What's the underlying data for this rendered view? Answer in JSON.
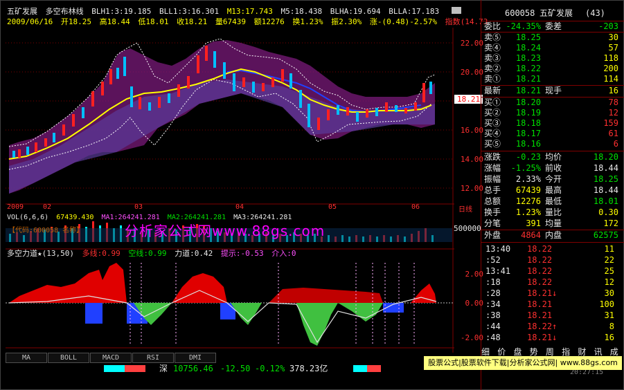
{
  "header": {
    "stock_name": "五矿发展",
    "indicator_name": "多空布林线",
    "blh1": "BLH1:3:19.185",
    "bll1": "BLL1:3:16.301",
    "m13": "M13:17.743",
    "m5": "M5:18.438",
    "blha": "BLHA:19.694",
    "blla": "BLLA:17.183",
    "date": "2009/06/16",
    "open": "开18.25",
    "high": "高18.44",
    "low": "低18.01",
    "close": "收18.21",
    "volume": "量67439",
    "amount": "额12276",
    "turnover": "换1.23%",
    "amplitude": "振2.30%",
    "change": "涨-(0.48)-2.57%",
    "index": "指数(14.73"
  },
  "price_axis": [
    "22.00",
    "20.00",
    "18.00",
    "16.00",
    "14.00",
    "12.00"
  ],
  "current_price_tag": "18.21",
  "date_axis": [
    "2009",
    "02",
    "03",
    "04",
    "05",
    "06",
    "日线"
  ],
  "volume_header": {
    "label": "VOL(6,6,6)",
    "value": "67439.430",
    "ma1": "MA1:264241.281",
    "ma2": "MA2:264241.281",
    "ma3": "MA3:264241.281",
    "sub": "【代码:600058 名称】"
  },
  "volume_axis": [
    "500000"
  ],
  "watermark": "分析家公式网www.88gs.com",
  "power_header": {
    "title": "多空力道★(13,50)",
    "duo": "多线:0.99",
    "kong": "空线:0.99",
    "lidao": "力道:0.42",
    "tishi": "提示:-0.53",
    "jieru": "介入:0"
  },
  "power_axis": [
    "2.00",
    "0.00",
    "-2.00"
  ],
  "tabs": [
    "MA",
    "BOLL",
    "MACD",
    "RSI",
    "DMI"
  ],
  "status": {
    "market": "深",
    "index_value": "10756.46",
    "change": "-12.50",
    "pct": "-0.12%",
    "amount": "378.23亿"
  },
  "banner": "股票公式|股票软件下载|分析家公式网| www.88gs.com",
  "right_panel": {
    "code": "600058",
    "name": "五矿发展",
    "count": "(43)",
    "weibi_label": "委比",
    "weibi": "-24.35%",
    "weicha_label": "委差",
    "weicha": "-203",
    "asks": [
      {
        "label": "卖⑤",
        "price": "18.25",
        "vol": "30"
      },
      {
        "label": "卖④",
        "price": "18.24",
        "vol": "57"
      },
      {
        "label": "卖③",
        "price": "18.23",
        "vol": "118"
      },
      {
        "label": "卖②",
        "price": "18.22",
        "vol": "200"
      },
      {
        "label": "卖①",
        "price": "18.21",
        "vol": "114"
      }
    ],
    "last_label": "最新",
    "last": "18.21",
    "hand_label": "现手",
    "hand": "16",
    "bids": [
      {
        "label": "买①",
        "price": "18.20",
        "vol": "78"
      },
      {
        "label": "买②",
        "price": "18.19",
        "vol": "12"
      },
      {
        "label": "买③",
        "price": "18.18",
        "vol": "159"
      },
      {
        "label": "买④",
        "price": "18.17",
        "vol": "61"
      },
      {
        "label": "买⑤",
        "price": "18.16",
        "vol": "6"
      }
    ],
    "stats": [
      {
        "l1": "涨跌",
        "v1": "-0.23",
        "l2": "均价",
        "v2": "18.20"
      },
      {
        "l1": "涨幅",
        "v1": "-1.25%",
        "l2": "前收",
        "v2": "18.44"
      },
      {
        "l1": "振幅",
        "v1": "2.33%",
        "l2": "今开",
        "v2": "18.25"
      },
      {
        "l1": "总手",
        "v1": "67439",
        "l2": "最高",
        "v2": "18.44"
      },
      {
        "l1": "总额",
        "v1": "12276",
        "l2": "最低",
        "v2": "18.01"
      },
      {
        "l1": "换手",
        "v1": "1.23%",
        "l2": "量比",
        "v2": "0.30"
      },
      {
        "l1": "分笔",
        "v1": "391",
        "l2": "均量",
        "v2": "172"
      }
    ],
    "outer_label": "外盘",
    "outer": "4864",
    "inner_label": "内盘",
    "inner": "62575",
    "ticks": [
      {
        "time": "13:40",
        "price": "18.22",
        "vol": "11"
      },
      {
        "time": ":52",
        "price": "18.22",
        "vol": "22"
      },
      {
        "time": "13:41",
        "price": "18.22",
        "vol": "25"
      },
      {
        "time": ":18",
        "price": "18.22",
        "vol": "12"
      },
      {
        "time": ":28",
        "price": "18.21↓",
        "vol": "30"
      },
      {
        "time": ":34",
        "price": "18.21",
        "vol": "100"
      },
      {
        "time": ":38",
        "price": "18.21",
        "vol": "31"
      },
      {
        "time": ":44",
        "price": "18.22↑",
        "vol": "8"
      },
      {
        "time": ":48",
        "price": "18.21↓",
        "vol": "16"
      }
    ],
    "footer_tabs": "细 价 盘 势 周 指 财 讯 成 特 解",
    "clock": "20:27:15"
  }
}
